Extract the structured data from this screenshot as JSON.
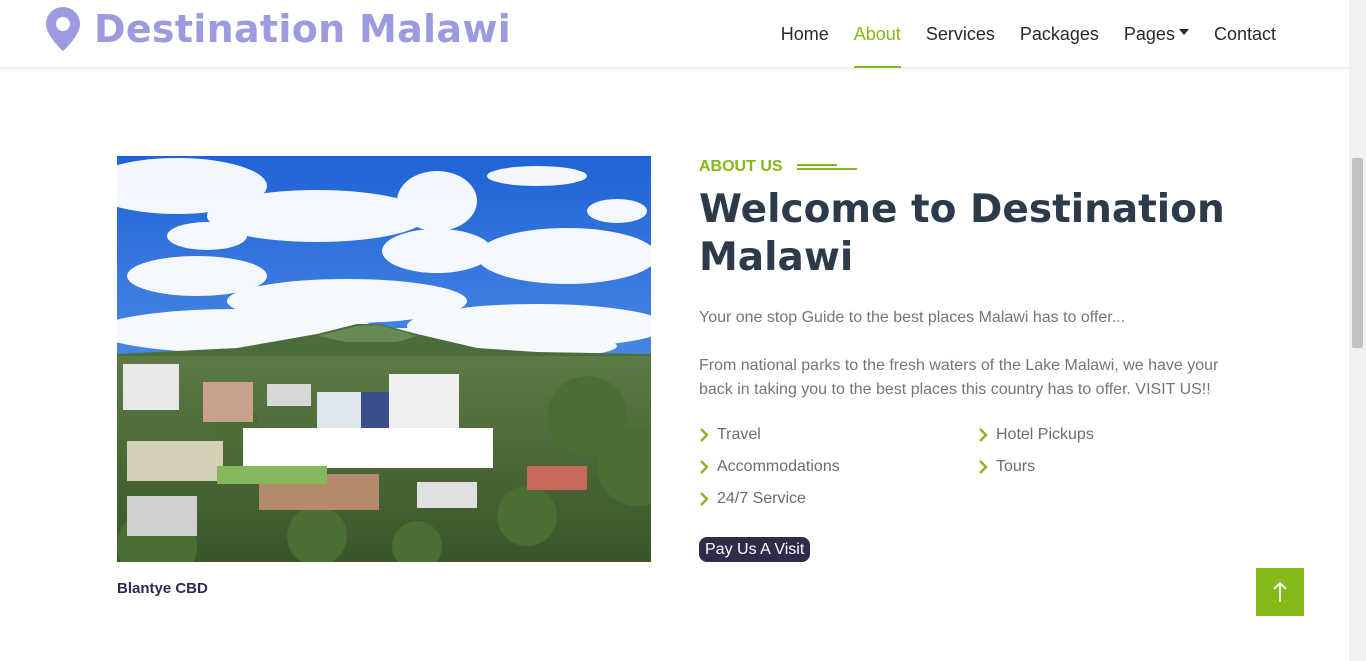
{
  "navbar": {
    "brand": "Destination Malawi",
    "brand_icon": "map-pin-icon",
    "links": [
      {
        "label": "Home",
        "active": false
      },
      {
        "label": "About",
        "active": true
      },
      {
        "label": "Services",
        "active": false
      },
      {
        "label": "Packages",
        "active": false
      },
      {
        "label": "Pages",
        "active": false,
        "dropdown": true
      },
      {
        "label": "Contact",
        "active": false
      }
    ]
  },
  "about": {
    "image_caption": "Blantye CBD",
    "section_label": "ABOUT US",
    "title": "Welcome to Destination Malawi",
    "intro": "Your one stop Guide to the best places Malawi has to offer...",
    "description": "From national parks to the fresh waters of the Lake Malawi, we have your back in taking you to the best places this country has to offer. VISIT US!!",
    "features": [
      "Travel",
      "Hotel Pickups",
      "Accommodations",
      "Tours",
      "24/7 Service"
    ],
    "button_label": "Pay Us A Visit"
  },
  "colors": {
    "accent": "#86b817",
    "brand": "#9d9be0",
    "heading": "#2c3a4a",
    "button_bg": "#2e2c4a"
  },
  "icons": {
    "feature_bullet": "chevron-right-icon",
    "back_to_top": "arrow-up-icon"
  }
}
